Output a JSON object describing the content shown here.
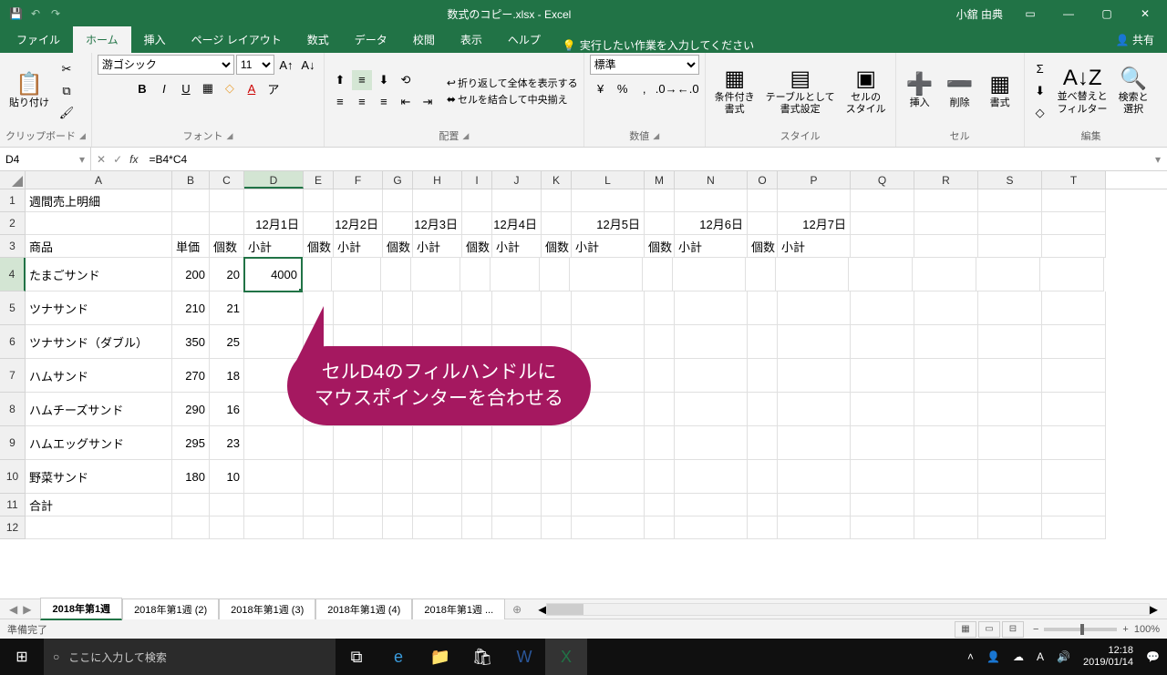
{
  "titlebar": {
    "title": "数式のコピー.xlsx - Excel",
    "user": "小舘 由典"
  },
  "tabs": {
    "file": "ファイル",
    "home": "ホーム",
    "insert": "挿入",
    "pagelayout": "ページ レイアウト",
    "formulas": "数式",
    "data": "データ",
    "review": "校閲",
    "view": "表示",
    "help": "ヘルプ",
    "tellme": "実行したい作業を入力してください",
    "share": "共有"
  },
  "ribbon": {
    "clipboard": {
      "paste": "貼り付け",
      "label": "クリップボード"
    },
    "font": {
      "name": "游ゴシック",
      "size": "11",
      "label": "フォント"
    },
    "align": {
      "wrap": "折り返して全体を表示する",
      "merge": "セルを結合して中央揃え",
      "label": "配置"
    },
    "number": {
      "format": "標準",
      "label": "数値"
    },
    "styles": {
      "cond": "条件付き\n書式",
      "table": "テーブルとして\n書式設定",
      "cell": "セルの\nスタイル",
      "label": "スタイル"
    },
    "cells": {
      "insert": "挿入",
      "delete": "削除",
      "format": "書式",
      "label": "セル"
    },
    "editing": {
      "sort": "並べ替えと\nフィルター",
      "find": "検索と\n選択",
      "label": "編集"
    }
  },
  "formula_bar": {
    "name_box": "D4",
    "formula": "=B4*C4"
  },
  "cols": [
    "A",
    "B",
    "C",
    "D",
    "E",
    "F",
    "G",
    "H",
    "I",
    "J",
    "K",
    "L",
    "M",
    "N",
    "O",
    "P",
    "Q",
    "R",
    "S",
    "T"
  ],
  "sheet": {
    "r1": {
      "A": "週間売上明細"
    },
    "r2": {
      "D": "12月1日",
      "F": "12月2日",
      "H": "12月3日",
      "J": "12月4日",
      "L": "12月5日",
      "N": "12月6日",
      "P": "12月7日"
    },
    "r3": {
      "A": "商品",
      "B": "単価",
      "C": "個数",
      "D": "小計",
      "E": "個数",
      "F": "小計",
      "G": "個数",
      "H": "小計",
      "I": "個数",
      "J": "小計",
      "K": "個数",
      "L": "小計",
      "M": "個数",
      "N": "小計",
      "O": "個数",
      "P": "小計"
    },
    "r4": {
      "A": "たまごサンド",
      "B": "200",
      "C": "20",
      "D": "4000"
    },
    "r5": {
      "A": "ツナサンド",
      "B": "210",
      "C": "21"
    },
    "r6": {
      "A": "ツナサンド（ダブル）",
      "B": "350",
      "C": "25"
    },
    "r7": {
      "A": "ハムサンド",
      "B": "270",
      "C": "18"
    },
    "r8": {
      "A": "ハムチーズサンド",
      "B": "290",
      "C": "16"
    },
    "r9": {
      "A": "ハムエッグサンド",
      "B": "295",
      "C": "23"
    },
    "r10": {
      "A": "野菜サンド",
      "B": "180",
      "C": "10"
    },
    "r11": {
      "A": "合計"
    }
  },
  "callout": {
    "line1": "セルD4のフィルハンドルに",
    "line2": "マウスポインターを合わせる"
  },
  "sheet_tabs": {
    "t1": "2018年第1週",
    "t2": "2018年第1週 (2)",
    "t3": "2018年第1週 (3)",
    "t4": "2018年第1週 (4)",
    "t5": "2018年第1週 ..."
  },
  "status": {
    "ready": "準備完了",
    "zoom": "100%"
  },
  "taskbar": {
    "search": "ここに入力して検索",
    "time": "12:18",
    "date": "2019/01/14"
  }
}
